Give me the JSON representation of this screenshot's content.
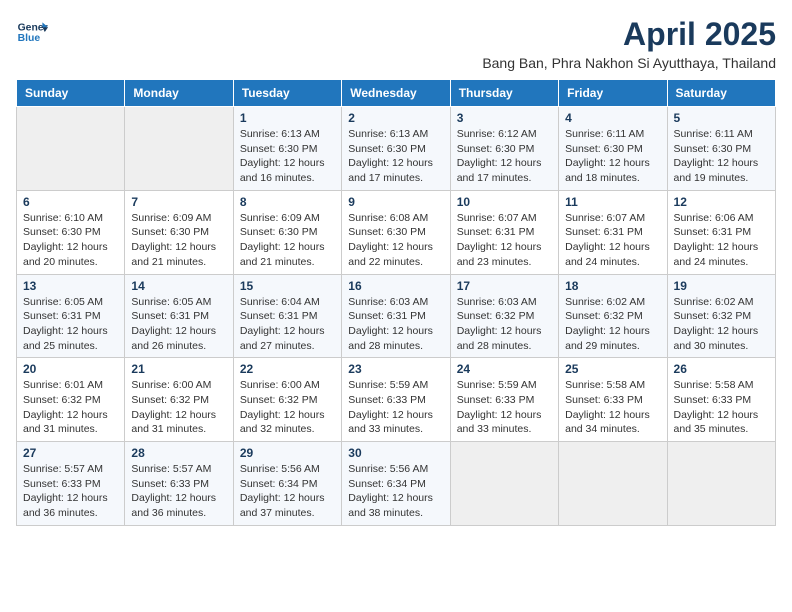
{
  "logo": {
    "line1": "General",
    "line2": "Blue"
  },
  "title": "April 2025",
  "subtitle": "Bang Ban, Phra Nakhon Si Ayutthaya, Thailand",
  "weekdays": [
    "Sunday",
    "Monday",
    "Tuesday",
    "Wednesday",
    "Thursday",
    "Friday",
    "Saturday"
  ],
  "weeks": [
    [
      {
        "day": "",
        "info": ""
      },
      {
        "day": "",
        "info": ""
      },
      {
        "day": "1",
        "sunrise": "Sunrise: 6:13 AM",
        "sunset": "Sunset: 6:30 PM",
        "daylight": "Daylight: 12 hours and 16 minutes."
      },
      {
        "day": "2",
        "sunrise": "Sunrise: 6:13 AM",
        "sunset": "Sunset: 6:30 PM",
        "daylight": "Daylight: 12 hours and 17 minutes."
      },
      {
        "day": "3",
        "sunrise": "Sunrise: 6:12 AM",
        "sunset": "Sunset: 6:30 PM",
        "daylight": "Daylight: 12 hours and 17 minutes."
      },
      {
        "day": "4",
        "sunrise": "Sunrise: 6:11 AM",
        "sunset": "Sunset: 6:30 PM",
        "daylight": "Daylight: 12 hours and 18 minutes."
      },
      {
        "day": "5",
        "sunrise": "Sunrise: 6:11 AM",
        "sunset": "Sunset: 6:30 PM",
        "daylight": "Daylight: 12 hours and 19 minutes."
      }
    ],
    [
      {
        "day": "6",
        "sunrise": "Sunrise: 6:10 AM",
        "sunset": "Sunset: 6:30 PM",
        "daylight": "Daylight: 12 hours and 20 minutes."
      },
      {
        "day": "7",
        "sunrise": "Sunrise: 6:09 AM",
        "sunset": "Sunset: 6:30 PM",
        "daylight": "Daylight: 12 hours and 21 minutes."
      },
      {
        "day": "8",
        "sunrise": "Sunrise: 6:09 AM",
        "sunset": "Sunset: 6:30 PM",
        "daylight": "Daylight: 12 hours and 21 minutes."
      },
      {
        "day": "9",
        "sunrise": "Sunrise: 6:08 AM",
        "sunset": "Sunset: 6:30 PM",
        "daylight": "Daylight: 12 hours and 22 minutes."
      },
      {
        "day": "10",
        "sunrise": "Sunrise: 6:07 AM",
        "sunset": "Sunset: 6:31 PM",
        "daylight": "Daylight: 12 hours and 23 minutes."
      },
      {
        "day": "11",
        "sunrise": "Sunrise: 6:07 AM",
        "sunset": "Sunset: 6:31 PM",
        "daylight": "Daylight: 12 hours and 24 minutes."
      },
      {
        "day": "12",
        "sunrise": "Sunrise: 6:06 AM",
        "sunset": "Sunset: 6:31 PM",
        "daylight": "Daylight: 12 hours and 24 minutes."
      }
    ],
    [
      {
        "day": "13",
        "sunrise": "Sunrise: 6:05 AM",
        "sunset": "Sunset: 6:31 PM",
        "daylight": "Daylight: 12 hours and 25 minutes."
      },
      {
        "day": "14",
        "sunrise": "Sunrise: 6:05 AM",
        "sunset": "Sunset: 6:31 PM",
        "daylight": "Daylight: 12 hours and 26 minutes."
      },
      {
        "day": "15",
        "sunrise": "Sunrise: 6:04 AM",
        "sunset": "Sunset: 6:31 PM",
        "daylight": "Daylight: 12 hours and 27 minutes."
      },
      {
        "day": "16",
        "sunrise": "Sunrise: 6:03 AM",
        "sunset": "Sunset: 6:31 PM",
        "daylight": "Daylight: 12 hours and 28 minutes."
      },
      {
        "day": "17",
        "sunrise": "Sunrise: 6:03 AM",
        "sunset": "Sunset: 6:32 PM",
        "daylight": "Daylight: 12 hours and 28 minutes."
      },
      {
        "day": "18",
        "sunrise": "Sunrise: 6:02 AM",
        "sunset": "Sunset: 6:32 PM",
        "daylight": "Daylight: 12 hours and 29 minutes."
      },
      {
        "day": "19",
        "sunrise": "Sunrise: 6:02 AM",
        "sunset": "Sunset: 6:32 PM",
        "daylight": "Daylight: 12 hours and 30 minutes."
      }
    ],
    [
      {
        "day": "20",
        "sunrise": "Sunrise: 6:01 AM",
        "sunset": "Sunset: 6:32 PM",
        "daylight": "Daylight: 12 hours and 31 minutes."
      },
      {
        "day": "21",
        "sunrise": "Sunrise: 6:00 AM",
        "sunset": "Sunset: 6:32 PM",
        "daylight": "Daylight: 12 hours and 31 minutes."
      },
      {
        "day": "22",
        "sunrise": "Sunrise: 6:00 AM",
        "sunset": "Sunset: 6:32 PM",
        "daylight": "Daylight: 12 hours and 32 minutes."
      },
      {
        "day": "23",
        "sunrise": "Sunrise: 5:59 AM",
        "sunset": "Sunset: 6:33 PM",
        "daylight": "Daylight: 12 hours and 33 minutes."
      },
      {
        "day": "24",
        "sunrise": "Sunrise: 5:59 AM",
        "sunset": "Sunset: 6:33 PM",
        "daylight": "Daylight: 12 hours and 33 minutes."
      },
      {
        "day": "25",
        "sunrise": "Sunrise: 5:58 AM",
        "sunset": "Sunset: 6:33 PM",
        "daylight": "Daylight: 12 hours and 34 minutes."
      },
      {
        "day": "26",
        "sunrise": "Sunrise: 5:58 AM",
        "sunset": "Sunset: 6:33 PM",
        "daylight": "Daylight: 12 hours and 35 minutes."
      }
    ],
    [
      {
        "day": "27",
        "sunrise": "Sunrise: 5:57 AM",
        "sunset": "Sunset: 6:33 PM",
        "daylight": "Daylight: 12 hours and 36 minutes."
      },
      {
        "day": "28",
        "sunrise": "Sunrise: 5:57 AM",
        "sunset": "Sunset: 6:33 PM",
        "daylight": "Daylight: 12 hours and 36 minutes."
      },
      {
        "day": "29",
        "sunrise": "Sunrise: 5:56 AM",
        "sunset": "Sunset: 6:34 PM",
        "daylight": "Daylight: 12 hours and 37 minutes."
      },
      {
        "day": "30",
        "sunrise": "Sunrise: 5:56 AM",
        "sunset": "Sunset: 6:34 PM",
        "daylight": "Daylight: 12 hours and 38 minutes."
      },
      {
        "day": "",
        "info": ""
      },
      {
        "day": "",
        "info": ""
      },
      {
        "day": "",
        "info": ""
      }
    ]
  ]
}
